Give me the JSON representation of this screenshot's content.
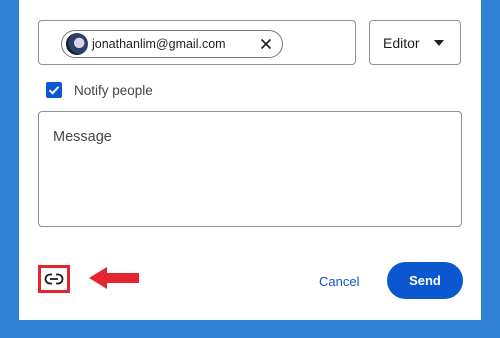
{
  "recipients": [
    {
      "email": "jonathanlim@gmail.com",
      "avatar_icon": "user-avatar",
      "remove_icon": "close-icon"
    }
  ],
  "role": {
    "selected": "Editor",
    "icon": "caret-down-icon"
  },
  "notify": {
    "label": "Notify people",
    "checked": true
  },
  "message": {
    "placeholder": "Message"
  },
  "actions": {
    "copy_link_icon": "link-icon",
    "cancel_label": "Cancel",
    "send_label": "Send"
  },
  "annotation": {
    "type": "arrow",
    "color": "#e3252f",
    "highlight": "copy-link-button"
  },
  "colors": {
    "background": "#2f80d6",
    "accent": "#0b57d0",
    "highlight": "#e3252f"
  }
}
